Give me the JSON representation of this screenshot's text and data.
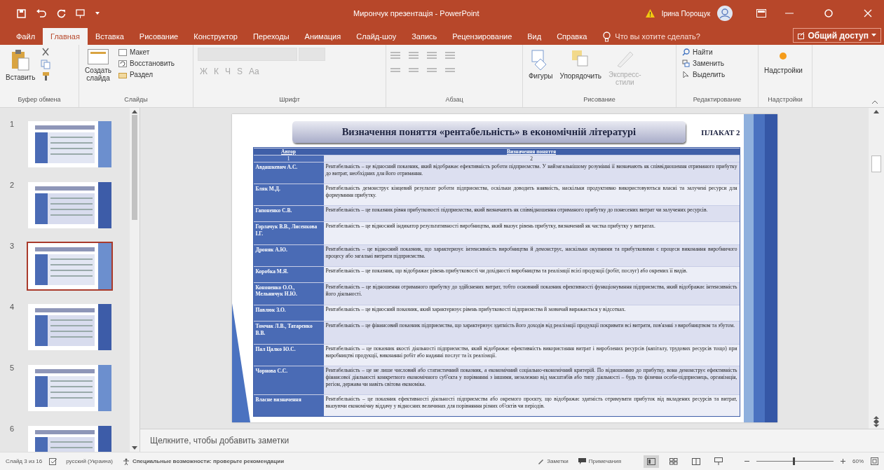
{
  "window": {
    "title": "Мирончук презентація  -  PowerPoint",
    "user": "Ірина Порощук"
  },
  "tabs": [
    {
      "label": "Файл",
      "selected": false
    },
    {
      "label": "Главная",
      "selected": true
    },
    {
      "label": "Вставка",
      "selected": false
    },
    {
      "label": "Рисование",
      "selected": false
    },
    {
      "label": "Конструктор",
      "selected": false
    },
    {
      "label": "Переходы",
      "selected": false
    },
    {
      "label": "Анимация",
      "selected": false
    },
    {
      "label": "Слайд-шоу",
      "selected": false
    },
    {
      "label": "Запись",
      "selected": false
    },
    {
      "label": "Рецензирование",
      "selected": false
    },
    {
      "label": "Вид",
      "selected": false
    },
    {
      "label": "Справка",
      "selected": false
    }
  ],
  "tell_me": {
    "placeholder": "Что вы хотите сделать?"
  },
  "share_button": "Общий доступ",
  "ribbon": {
    "clipboard": {
      "label": "Буфер обмена",
      "paste": "Вставить"
    },
    "slides": {
      "label": "Слайды",
      "new_slide": [
        "Создать",
        "слайда"
      ],
      "layout": "Макет",
      "reset": "Восстановить",
      "section": "Раздел"
    },
    "font": {
      "label": "Шрифт",
      "disabled": true,
      "glyphs": [
        "Ж",
        "К",
        "Ч",
        "S",
        "Aa"
      ]
    },
    "paragraph": {
      "label": "Абзац",
      "disabled": true
    },
    "drawing": {
      "label": "Рисование",
      "shapes": "Фигуры",
      "arrange": "Упорядочить",
      "quick_styles": {
        "label": [
          "Экспресс-",
          "стили"
        ],
        "disabled": true
      }
    },
    "editing": {
      "label": "Редактирование",
      "find": "Найти",
      "replace": "Заменить",
      "select": "Выделить"
    },
    "addins": {
      "label": "Надстройки",
      "button": "Надстройки"
    }
  },
  "thumbnails": [
    {
      "number": "1",
      "selected": false
    },
    {
      "number": "2",
      "selected": false
    },
    {
      "number": "3",
      "selected": true
    },
    {
      "number": "4",
      "selected": false
    },
    {
      "number": "5",
      "selected": false
    },
    {
      "number": "6",
      "selected": false
    }
  ],
  "slide": {
    "title": "Визначення поняття «рентабельність» в економічній літературі",
    "poster_label": "ПЛАКАТ 2",
    "table": {
      "columns": [
        "Автор",
        "Визначення поняття"
      ],
      "column_numbers": [
        "1",
        "2"
      ],
      "rows": [
        {
          "author": "Авдашкевич А.С.",
          "definition": "Рентабельність – це відносний показник, який відображає ефективність роботи підприємства. У найзагальнішому розумінні її визначають як співвідношення отриманого прибутку до витрат, необхідних для його отримання."
        },
        {
          "author": "Бляк М.Д.",
          "definition": "Рентабельність демонструє кінцевий результат роботи підприємства, оскільки доводить наявність, наскільки продуктивно використовуються власні та залучені ресурси для формування прибутку."
        },
        {
          "author": "Гапоненко С.В.",
          "definition": "Рентабельність – це показник рівня прибутковості підприємства, який визначають як співвідношення отриманого прибутку до понесених витрат чи залучених ресурсів."
        },
        {
          "author": "Горлачук В.В., Лисенкова І.Г.",
          "definition": "Рентабельність – це відносний індикатор результативності виробництва, який вказує рівень прибутку, визначений як частка прибутку у витратах."
        },
        {
          "author": "Дроняк А.Ю.",
          "definition": "Рентабельність – це відносний показник, що характеризує інтенсивність виробництва й демонструє, наскільки окупними та прибутковими є процеси виконання виробничого процесу або загальні витрати підприємства."
        },
        {
          "author": "Коробка М.Я.",
          "definition": "Рентабельність – це показник, що відображає рівень прибутковості чи дохідності виробництва та реалізації всієї продукції (робіт, послуг) або окремих її видів."
        },
        {
          "author": "Кононенко О.О., Мельничук Н.Ю.",
          "definition": "Рентабельність – це відношення отриманого прибутку до здійснених витрат, тобто основний показник ефективності функціонування підприємства, який відображає інтенсивність його діяльності."
        },
        {
          "author": "Павлюк З.О.",
          "definition": "Рентабельність – це відносний показник, який характеризує рівень прибутковості підприємства й зазвичай виражається у відсотках."
        },
        {
          "author": "Томчак Л.В., Татаренко В.В.",
          "definition": "Рентабельність – це фінансовий показник підприємства, що характеризує здатність його доходів від реалізації продукції покривати всі витрати, пов'язані з виробництвом та збутом."
        },
        {
          "author": "Пал Цалко Ю.С.",
          "definition": "Рентабельність – це показник якості діяльності підприємства, який відображає ефективність використання витрат і вироблених ресурсів (капіталу, трудових ресурсів тощо) при виробництві продукції, виконанні робіт або наданні послуг та їх реалізації."
        },
        {
          "author": "Чорнова С.С.",
          "definition": "Рентабельність – це не лише числовий або статистичний показник, а економічний соціально-економічний критерій. По відношенню до прибутку, вона демонструє ефективність фінансової діяльності конкретного економічного суб'єкта у порівнянні з іншими, незалежно від масштабів або типу діяльності – будь то фізична особа-підприємець, організація, регіон, держава чи навіть світова економіка."
        },
        {
          "author": "Власне визначення",
          "definition": "Рентабельність – це показник ефективності діяльності підприємства або окремого проєкту, що відображає здатність отримувати прибуток від вкладених ресурсів та витрат, вказуючи економічну віддачу у відносних величинах для порівняння різних об'єктів чи періодів."
        }
      ]
    }
  },
  "notes": {
    "placeholder": "Щелкните, чтобы добавить заметки"
  },
  "status_bar": {
    "slide_counter": "Слайд 3 из 16",
    "language": "русский (Украина)",
    "accessibility": "Специальные возможности: проверьте рекомендации",
    "notes_button": "Заметки",
    "comments_button": "Примечания",
    "views": [
      {
        "kind": "normal",
        "selected": true
      },
      {
        "kind": "sorter",
        "selected": false
      },
      {
        "kind": "reading",
        "selected": false
      },
      {
        "kind": "slideshow",
        "selected": false
      }
    ],
    "zoom": {
      "level": 0.48,
      "reading": "60%"
    }
  }
}
